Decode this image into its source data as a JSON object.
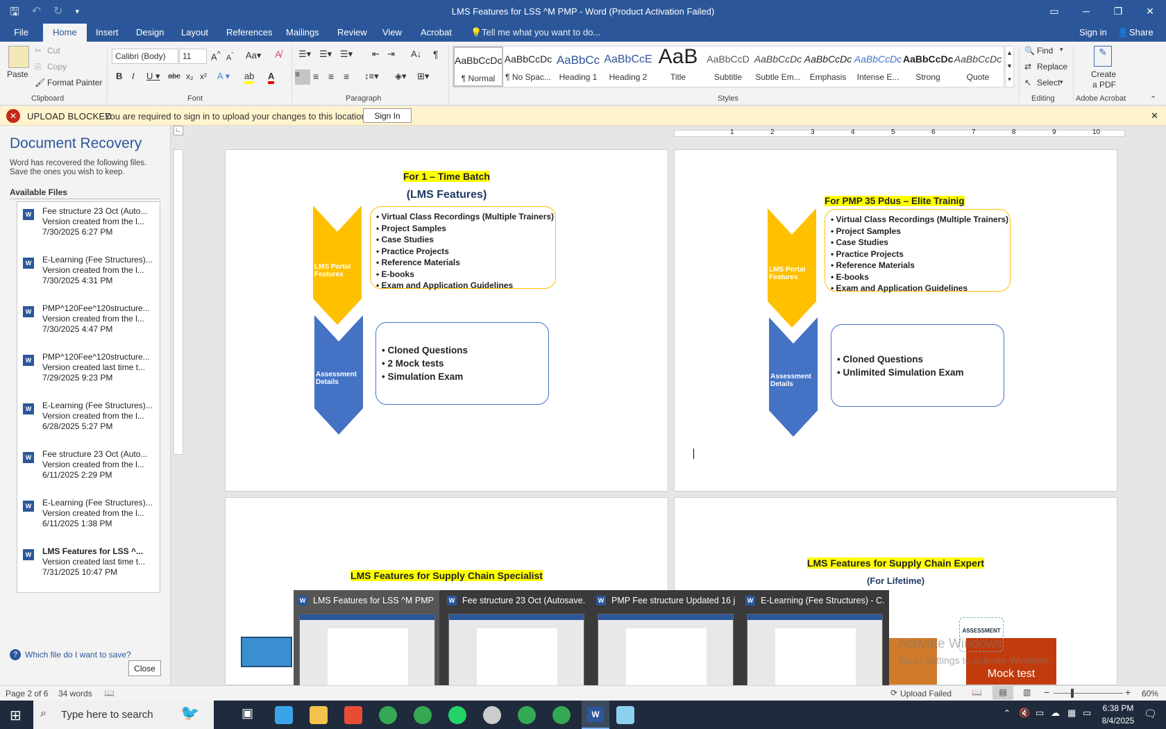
{
  "window": {
    "title": "LMS Features for LSS ^M PMP  -  Word (Product Activation Failed)",
    "qat_icons": [
      "save-icon",
      "undo-icon",
      "redo-icon",
      "customize-icon"
    ]
  },
  "tabs": {
    "file": "File",
    "home": "Home",
    "insert": "Insert",
    "design": "Design",
    "layout": "Layout",
    "references": "References",
    "mailings": "Mailings",
    "review": "Review",
    "view": "View",
    "acrobat": "Acrobat",
    "tell_me": "Tell me what you want to do...",
    "sign_in": "Sign in",
    "share": "Share"
  },
  "ribbon": {
    "clipboard": {
      "paste": "Paste",
      "cut": "Cut",
      "copy": "Copy",
      "format_painter": "Format Painter",
      "label": "Clipboard"
    },
    "font": {
      "name": "Calibri (Body)",
      "size": "11",
      "label": "Font"
    },
    "paragraph": {
      "label": "Paragraph"
    },
    "styles": {
      "label": "Styles",
      "items": [
        {
          "preview": "AaBbCcDc",
          "name": "¶ Normal"
        },
        {
          "preview": "AaBbCcDc",
          "name": "¶ No Spac..."
        },
        {
          "preview": "AaBbCc",
          "name": "Heading 1"
        },
        {
          "preview": "AaBbCcE",
          "name": "Heading 2"
        },
        {
          "preview": "AaB",
          "name": "Title"
        },
        {
          "preview": "AaBbCcD",
          "name": "Subtitle"
        },
        {
          "preview": "AaBbCcDc",
          "name": "Subtle Em..."
        },
        {
          "preview": "AaBbCcDc",
          "name": "Emphasis"
        },
        {
          "preview": "AaBbCcDc",
          "name": "Intense E..."
        },
        {
          "preview": "AaBbCcDc",
          "name": "Strong"
        },
        {
          "preview": "AaBbCcDc",
          "name": "Quote"
        }
      ]
    },
    "editing": {
      "find": "Find",
      "replace": "Replace",
      "select": "Select",
      "label": "Editing"
    },
    "acrobat": {
      "create": "Create",
      "pdf": "a PDF",
      "label": "Adobe Acrobat"
    }
  },
  "message_bar": {
    "title": "UPLOAD BLOCKED",
    "text": "You are required to sign in to upload your changes to this location.",
    "button": "Sign In"
  },
  "recovery": {
    "title": "Document Recovery",
    "desc1": "Word has recovered the following files.",
    "desc2": "Save the ones you wish to keep.",
    "available": "Available Files",
    "files": [
      {
        "name": "Fee structure 23 Oct (Auto...",
        "note": "Version created from the l...",
        "date": "7/30/2025 6:27 PM"
      },
      {
        "name": "E-Learning (Fee Structures)...",
        "note": "Version created from the l...",
        "date": "7/30/2025 4:31 PM"
      },
      {
        "name": "PMP^120Fee^120structure...",
        "note": "Version created from the l...",
        "date": "7/30/2025 4:47 PM"
      },
      {
        "name": "PMP^120Fee^120structure...",
        "note": "Version created last time t...",
        "date": "7/29/2025 9:23 PM"
      },
      {
        "name": "E-Learning (Fee Structures)...",
        "note": "Version created from the l...",
        "date": "6/28/2025 5:27 PM"
      },
      {
        "name": "Fee structure 23 Oct (Auto...",
        "note": "Version created from the l...",
        "date": "6/11/2025 2:29 PM"
      },
      {
        "name": "E-Learning (Fee Structures)...",
        "note": "Version created from the l...",
        "date": "6/11/2025 1:38 PM"
      },
      {
        "name": "LMS Features for LSS ^...",
        "note": "Version created last time t...",
        "date": "7/31/2025 10:47 PM"
      }
    ],
    "help": "Which file do I want to save?",
    "close": "Close"
  },
  "page1": {
    "heading1": "For 1 – Time Batch",
    "heading2": "(LMS Features)",
    "portal_label": "LMS Portal Features",
    "assessment_label": "Assessment Details",
    "features": [
      "Virtual Class Recordings (Multiple Trainers)",
      "Project Samples",
      "Case Studies",
      "Practice Projects",
      "Reference Materials",
      "E-books",
      "Exam and Application Guidelines"
    ],
    "assessments": [
      "Cloned Questions",
      "2 Mock tests",
      "Simulation Exam"
    ]
  },
  "page2": {
    "heading1": "For PMP 35 Pdus – Elite Trainig",
    "portal_label": "LMS Portal Features",
    "assessment_label": "Assessment Details",
    "features": [
      "Virtual Class Recordings (Multiple Trainers)",
      "Project Samples",
      "Case Studies",
      "Practice Projects",
      "Reference Materials",
      "E-books",
      "Exam and Application Guidelines"
    ],
    "assessments": [
      "Cloned Questions",
      "Unlimited  Simulation Exam"
    ]
  },
  "page3": {
    "heading": "LMS Features for Supply Chain Specialist"
  },
  "page4": {
    "heading": "LMS Features for Supply Chain Expert",
    "sub": "(For Lifetime)",
    "mock": "Mock test",
    "assess": "ASSESSMENT"
  },
  "watermark": {
    "line1": "Activate Windows",
    "line2": "Go to Settings to activate Windows."
  },
  "previews": [
    {
      "title": "LMS Features for LSS ^M PMP ..."
    },
    {
      "title": "Fee structure 23 Oct (Autosave..."
    },
    {
      "title": "PMP Fee structure Updated 16 j..."
    },
    {
      "title": "E-Learning (Fee Structures) - C..."
    }
  ],
  "status": {
    "page": "Page 2 of 6",
    "words": "34 words",
    "upload": "Upload Failed",
    "zoom": "60%"
  },
  "taskbar": {
    "search": "Type here to search",
    "time": "6:38 PM",
    "date": "8/4/2025"
  },
  "ruler_numbers": [
    "1",
    "2",
    "3",
    "4",
    "5",
    "6",
    "7",
    "8",
    "9",
    "10"
  ]
}
